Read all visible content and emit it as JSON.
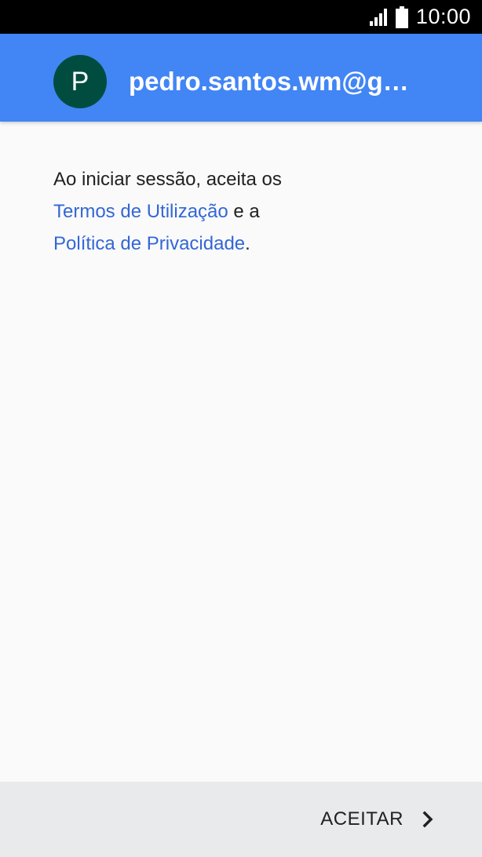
{
  "status_bar": {
    "time": "10:00",
    "icons": [
      "signal-icon",
      "battery-icon"
    ]
  },
  "account": {
    "initial": "P",
    "email": "pedro.santos.wm@gmail.com",
    "header_color": "#4285f4",
    "avatar_color": "#004d40"
  },
  "terms": {
    "intro": "Ao iniciar sessão, aceita os",
    "terms_link": "Termos de Utilização",
    "connector": " e a",
    "privacy_link": "Política de Privacidade",
    "end": ".",
    "link_color": "#3367d6"
  },
  "footer": {
    "accept_label": "ACEITAR",
    "accept_icon": "chevron-right-icon"
  }
}
